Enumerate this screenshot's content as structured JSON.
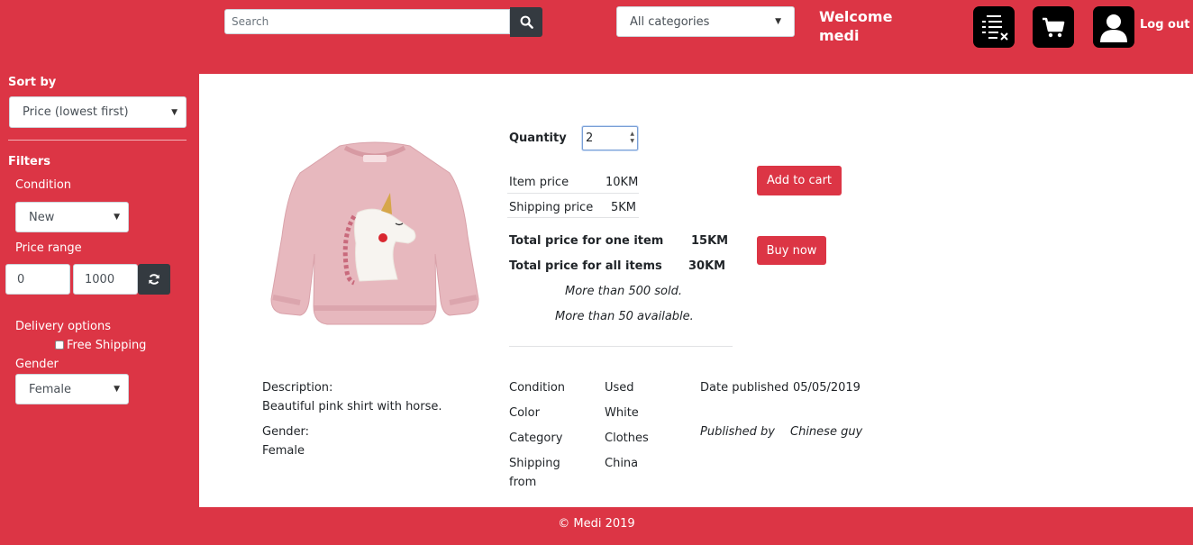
{
  "header": {
    "search_placeholder": "Search",
    "category_select": "All categories",
    "welcome_line1": "Welcome",
    "welcome_line2": "medi",
    "logout_label": "Log out"
  },
  "sidebar": {
    "sort_heading": "Sort by",
    "sort_value": "Price (lowest first)",
    "filters_heading": "Filters",
    "condition_label": "Condition",
    "condition_value": "New",
    "price_range_label": "Price range",
    "price_min": "0",
    "price_max": "1000",
    "delivery_label": "Delivery options",
    "free_shipping_label": "Free Shipping",
    "gender_label": "Gender",
    "gender_value": "Female"
  },
  "product": {
    "quantity_label": "Quantity",
    "quantity_value": "2",
    "item_price_label": "Item price",
    "item_price_value": "10KM",
    "shipping_price_label": "Shipping price",
    "shipping_price_value": "5KM",
    "total_one_label": "Total price for one item",
    "total_one_value": "15KM",
    "total_all_label": "Total price for all items",
    "total_all_value": "30KM",
    "sold_text": "More than 500 sold.",
    "available_text": "More than 50 available.",
    "add_to_cart_label": "Add to cart",
    "buy_now_label": "Buy now",
    "description_label": "Description:",
    "description_value": "Beautiful pink shirt with horse.",
    "gender_label": "Gender:",
    "gender_value": "Female",
    "condition_label": "Condition",
    "condition_value": "Used",
    "color_label": "Color",
    "color_value": "White",
    "category_label": "Category",
    "category_value": "Clothes",
    "shipping_from_label_1": "Shipping",
    "shipping_from_label_2": "from",
    "shipping_from_value": "China",
    "date_published_label": "Date published",
    "date_published_value": "05/05/2019",
    "published_by_label": "Published by",
    "published_by_value": "Chinese guy"
  },
  "footer": {
    "copyright": "© Medi 2019"
  },
  "colors": {
    "brand": "#dc3545",
    "dark_button": "#343a40"
  }
}
